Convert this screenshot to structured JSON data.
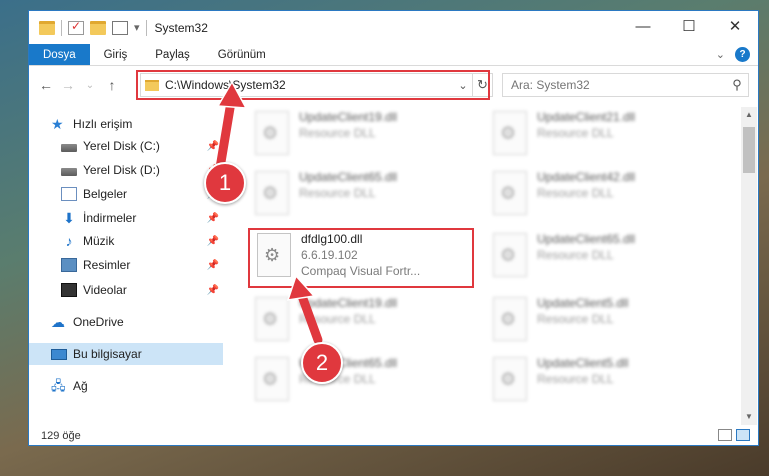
{
  "window": {
    "title": "System32"
  },
  "ribbon": {
    "tabs": [
      "Dosya",
      "Giriş",
      "Paylaş",
      "Görünüm"
    ]
  },
  "address": {
    "path": "C:\\Windows\\System32"
  },
  "search": {
    "placeholder": "Ara: System32"
  },
  "sidebar": {
    "items": [
      {
        "label": "Hızlı erişim",
        "icon": "star-icon"
      },
      {
        "label": "Yerel Disk (C:)",
        "icon": "drive-icon"
      },
      {
        "label": "Yerel Disk (D:)",
        "icon": "drive-icon"
      },
      {
        "label": "Belgeler",
        "icon": "documents-icon"
      },
      {
        "label": "İndirmeler",
        "icon": "download-icon"
      },
      {
        "label": "Müzik",
        "icon": "music-icon"
      },
      {
        "label": "Resimler",
        "icon": "pictures-icon"
      },
      {
        "label": "Videolar",
        "icon": "videos-icon"
      },
      {
        "label": "OneDrive",
        "icon": "cloud-icon"
      },
      {
        "label": "Bu bilgisayar",
        "icon": "computer-icon"
      },
      {
        "label": "Ağ",
        "icon": "network-icon"
      }
    ]
  },
  "files": [
    {
      "name": "UpdateClient19.dll",
      "sub": "Resource DLL"
    },
    {
      "name": "UpdateClient21.dll",
      "sub": "Resource DLL"
    },
    {
      "name": "UpdateClient65.dll",
      "sub": "Resource DLL"
    },
    {
      "name": "UpdateClient42.dll",
      "sub": "Resource DLL"
    },
    {
      "name": "dfdlg100.dll",
      "sub": "6.6.19.102",
      "sub2": "Compaq Visual Fortr..."
    },
    {
      "name": "UpdateClient65.dll",
      "sub": "Resource DLL"
    },
    {
      "name": "UpdateClient19.dll",
      "sub": "Resource DLL"
    },
    {
      "name": "UpdateClient5.dll",
      "sub": "Resource DLL"
    },
    {
      "name": "UpdateClient65.dll",
      "sub": "Resource DLL"
    },
    {
      "name": "UpdateClient5.dll",
      "sub": "Resource DLL"
    }
  ],
  "status": {
    "count": "129 öğe"
  },
  "annotations": {
    "badge1": "1",
    "badge2": "2",
    "color": "#e0383e"
  }
}
